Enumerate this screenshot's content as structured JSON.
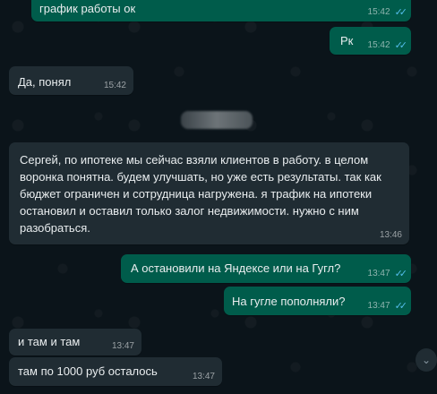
{
  "messages": [
    {
      "text": "график работы ок",
      "time": "15:42",
      "ticks": "✓✓"
    },
    {
      "text": "Рк",
      "time": "15:42",
      "ticks": "✓✓"
    },
    {
      "text": "Да, понял",
      "time": "15:42"
    },
    {
      "text": "Сергей, по ипотеке мы сейчас взяли клиентов в работу. в целом воронка понятна. будем улучшать, но уже есть результаты. так как бюджет ограничен и сотрудница нагружена. я трафик на ипотеки остановил и оставил только залог недвижимости. нужно с ним разобраться.",
      "time": "13:46"
    },
    {
      "text": "А остановили на Яндексе или на Гугл?",
      "time": "13:47",
      "ticks": "✓✓"
    },
    {
      "text": "На гугле пополняли?",
      "time": "13:47",
      "ticks": "✓✓"
    },
    {
      "text": "и там и там",
      "time": "13:47"
    },
    {
      "text": "там по 1000 руб осталось",
      "time": "13:47"
    }
  ],
  "scroll_button": {
    "icon": "chevron-down-icon",
    "glyph": "⌄"
  },
  "colors": {
    "incoming": "#202c33",
    "outgoing": "#005c4b",
    "background": "#0b141a",
    "read_ticks": "#53bdeb"
  }
}
